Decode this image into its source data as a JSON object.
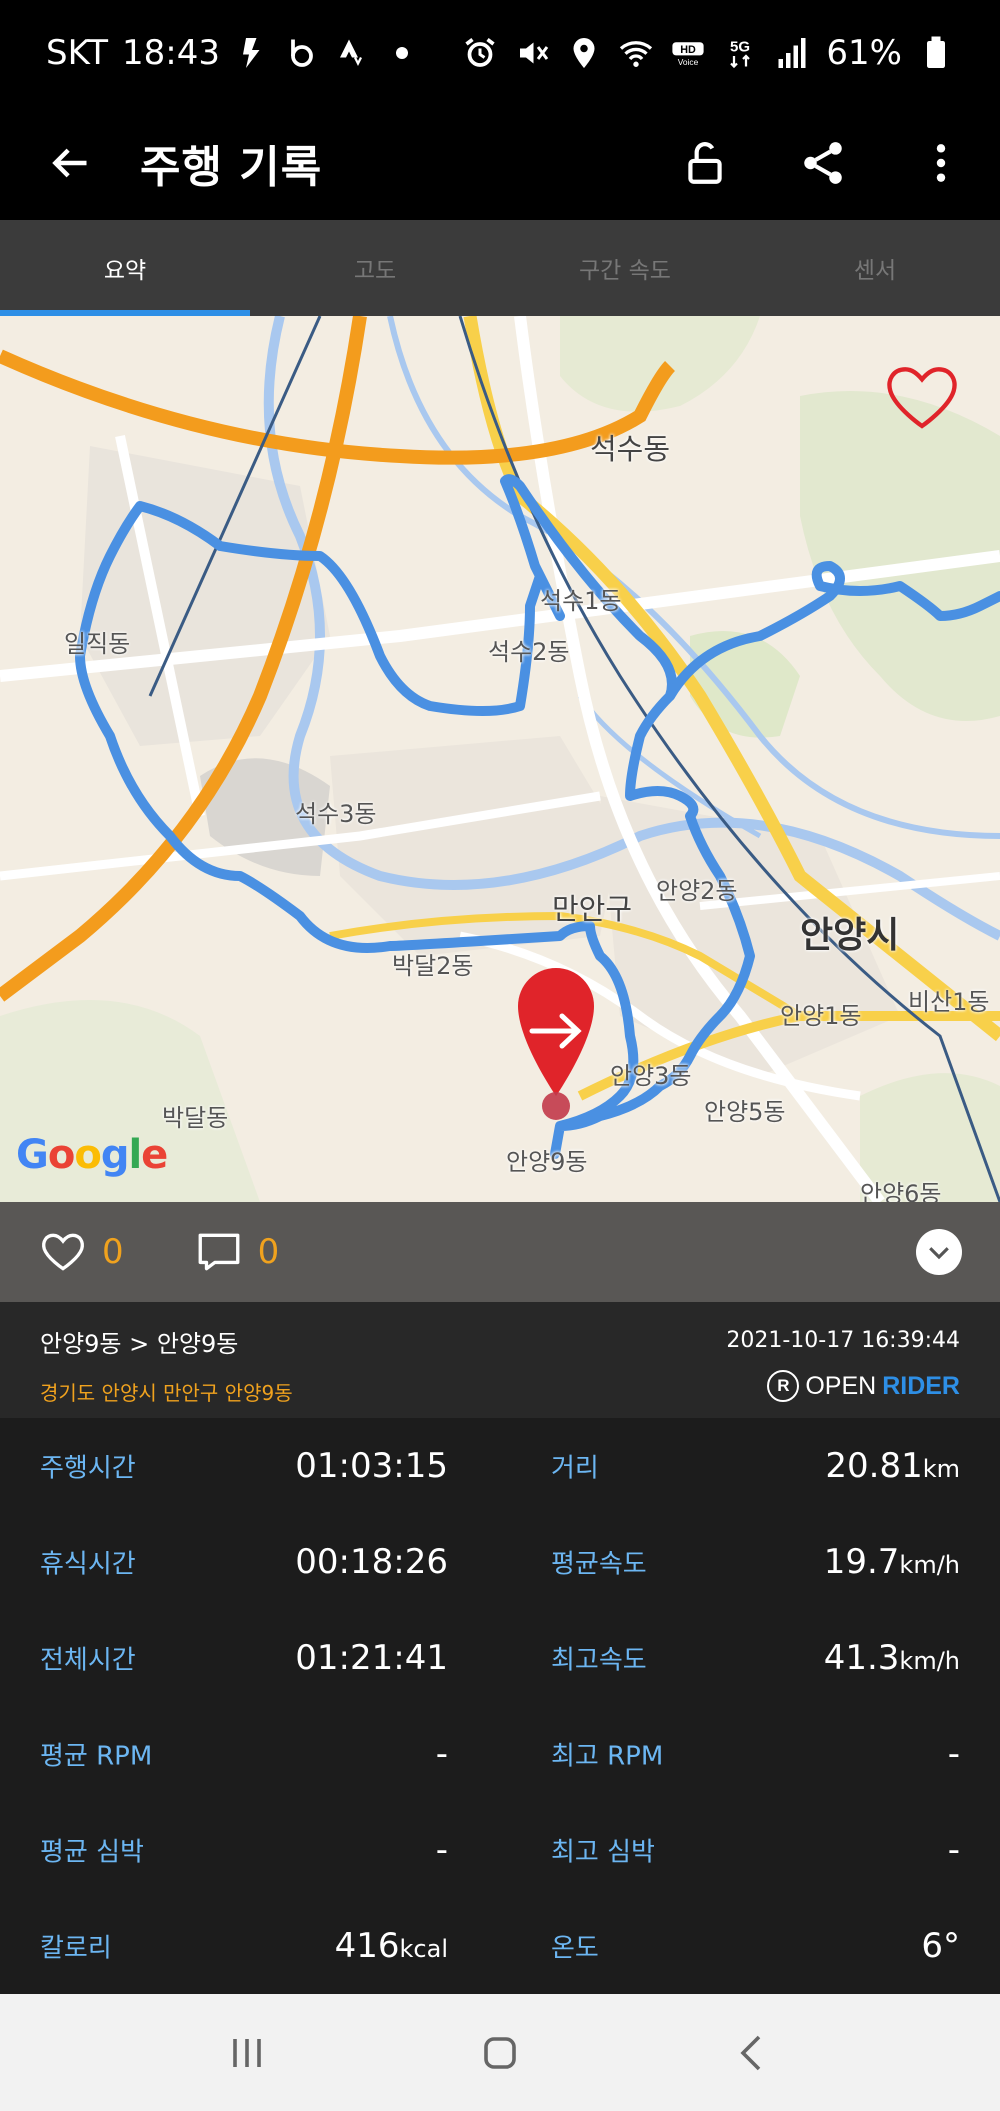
{
  "status_bar": {
    "carrier": "SKT",
    "time": "18:43",
    "battery": "61%",
    "left_icons": [
      "bolt-icon",
      "b-app-icon",
      "strava-icon",
      "dot-icon"
    ],
    "right_icons": [
      "alarm-icon",
      "mute-icon",
      "location-icon",
      "wifi-icon",
      "hd-voice-icon",
      "5g-icon",
      "signal-icon",
      "battery-icon"
    ]
  },
  "app_bar": {
    "title": "주행 기록",
    "icons": [
      "back-arrow-icon",
      "unlock-icon",
      "share-icon",
      "more-vert-icon"
    ]
  },
  "tabs": [
    {
      "label": "요약",
      "active": true
    },
    {
      "label": "고도",
      "active": false
    },
    {
      "label": "구간 속도",
      "active": false
    },
    {
      "label": "센서",
      "active": false
    }
  ],
  "map": {
    "provider": "Google",
    "labels": {
      "seoksu_dong": "석수동",
      "seoksu1": "석수1동",
      "seoksu2": "석수2동",
      "seoksu3": "석수3동",
      "iljik": "일직동",
      "manan": "만안구",
      "anyang2": "안양2동",
      "anyang_si": "안양시",
      "anyang1": "안양1동",
      "bisan1": "비산1동",
      "bakdal2": "박달2동",
      "anyang3": "안양3동",
      "anyang5": "안양5동",
      "bakdal": "박달동",
      "anyang9": "안양9동",
      "anyang6": "안양6동"
    },
    "route_color": "#4a90e2",
    "marker_color": "#e0242a"
  },
  "social": {
    "likes": "0",
    "comments": "0",
    "accent": "#f0a21e"
  },
  "route": {
    "path": "안양9동 > 안양9동",
    "address": "경기도 안양시 만안구 안양9동",
    "datetime": "2021-10-17 16:39:44",
    "brand_open": "OPEN",
    "brand_rider": "RIDER",
    "brand_badge": "R"
  },
  "stats": {
    "ride_time": {
      "label": "주행시간",
      "value": "01:03:15"
    },
    "distance": {
      "label": "거리",
      "value": "20.81",
      "unit": "km"
    },
    "rest_time": {
      "label": "휴식시간",
      "value": "00:18:26"
    },
    "avg_speed": {
      "label": "평균속도",
      "value": "19.7",
      "unit": "km/h"
    },
    "total_time": {
      "label": "전체시간",
      "value": "01:21:41"
    },
    "max_speed": {
      "label": "최고속도",
      "value": "41.3",
      "unit": "km/h"
    },
    "avg_rpm": {
      "label": "평균 RPM",
      "value": "-"
    },
    "max_rpm": {
      "label": "최고 RPM",
      "value": "-"
    },
    "avg_hr": {
      "label": "평균 심박",
      "value": "-"
    },
    "max_hr": {
      "label": "최고 심박",
      "value": "-"
    },
    "calories": {
      "label": "칼로리",
      "value": "416",
      "unit": "kcal"
    },
    "temperature": {
      "label": "온도",
      "value": "6°"
    }
  },
  "nav_bar": {
    "icons": [
      "recent-apps-icon",
      "home-icon",
      "back-icon"
    ]
  }
}
